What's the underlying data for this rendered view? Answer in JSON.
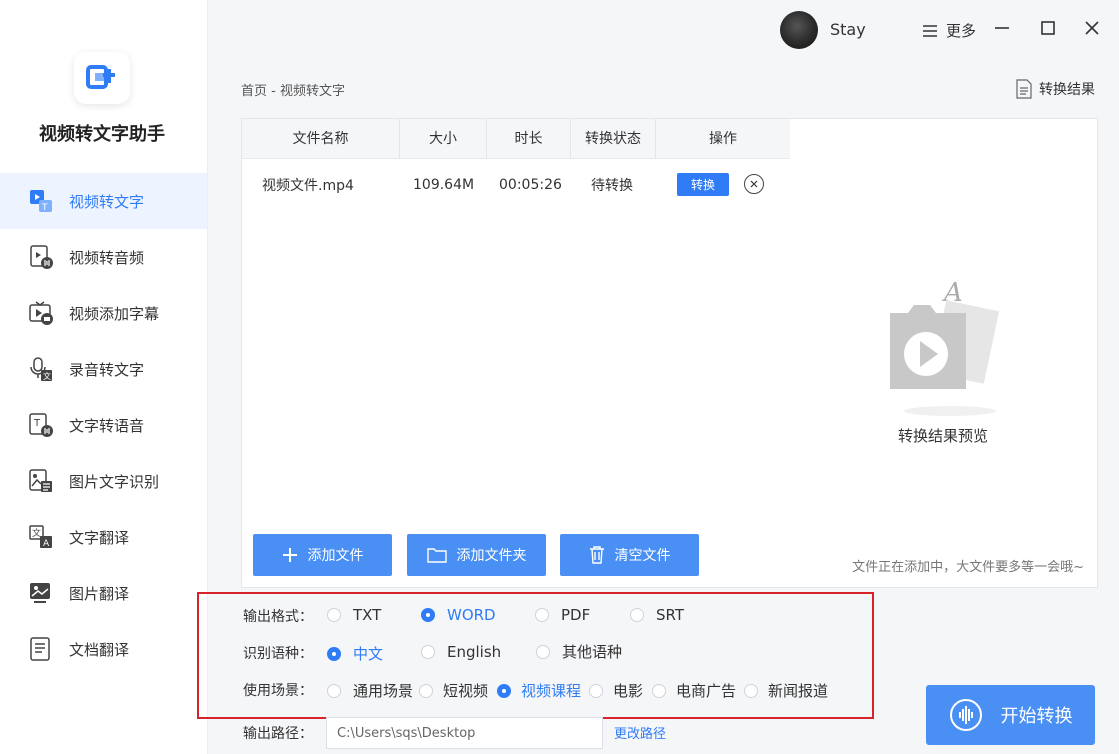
{
  "app": {
    "title": "视频转文字助手"
  },
  "user": {
    "name": "Stay"
  },
  "titlebar": {
    "more_label": "更多"
  },
  "sidebar": {
    "items": [
      {
        "label": "视频转文字",
        "icon": "video-to-text-icon",
        "active": true
      },
      {
        "label": "视频转音频",
        "icon": "video-to-audio-icon"
      },
      {
        "label": "视频添加字幕",
        "icon": "video-subtitle-icon"
      },
      {
        "label": "录音转文字",
        "icon": "mic-to-text-icon"
      },
      {
        "label": "文字转语音",
        "icon": "text-to-speech-icon"
      },
      {
        "label": "图片文字识别",
        "icon": "image-ocr-icon"
      },
      {
        "label": "文字翻译",
        "icon": "text-translate-icon"
      },
      {
        "label": "图片翻译",
        "icon": "image-translate-icon"
      },
      {
        "label": "文档翻译",
        "icon": "doc-translate-icon"
      }
    ]
  },
  "breadcrumb": "首页 - 视频转文字",
  "result_link": "转换结果",
  "table": {
    "headers": [
      "文件名称",
      "大小",
      "时长",
      "转换状态",
      "操作"
    ],
    "rows": [
      {
        "name": "视频文件.mp4",
        "size": "109.64M",
        "duration": "00:05:26",
        "status": "待转换",
        "action": "转换"
      }
    ]
  },
  "actions": {
    "add_file": "添加文件",
    "add_folder": "添加文件夹",
    "clear": "清空文件"
  },
  "preview": {
    "label": "转换结果预览",
    "hint": "文件正在添加中，大文件要多等一会哦~"
  },
  "options": {
    "format": {
      "label": "输出格式：",
      "choices": [
        "TXT",
        "WORD",
        "PDF",
        "SRT"
      ],
      "selected": "WORD"
    },
    "language": {
      "label": "识别语种：",
      "choices": [
        "中文",
        "English",
        "其他语种"
      ],
      "selected": "中文"
    },
    "scene": {
      "label": "使用场景：",
      "choices": [
        "通用场景",
        "短视频",
        "视频课程",
        "电影",
        "电商广告",
        "新闻报道"
      ],
      "selected": "视频课程"
    }
  },
  "output": {
    "label": "输出路径：",
    "path": "C:\\Users\\sqs\\Desktop",
    "change": "更改路径"
  },
  "start_button": "开始转换",
  "colors": {
    "accent": "#2f7cf6",
    "button": "#4a90f4",
    "highlight_border": "#d9232b"
  }
}
